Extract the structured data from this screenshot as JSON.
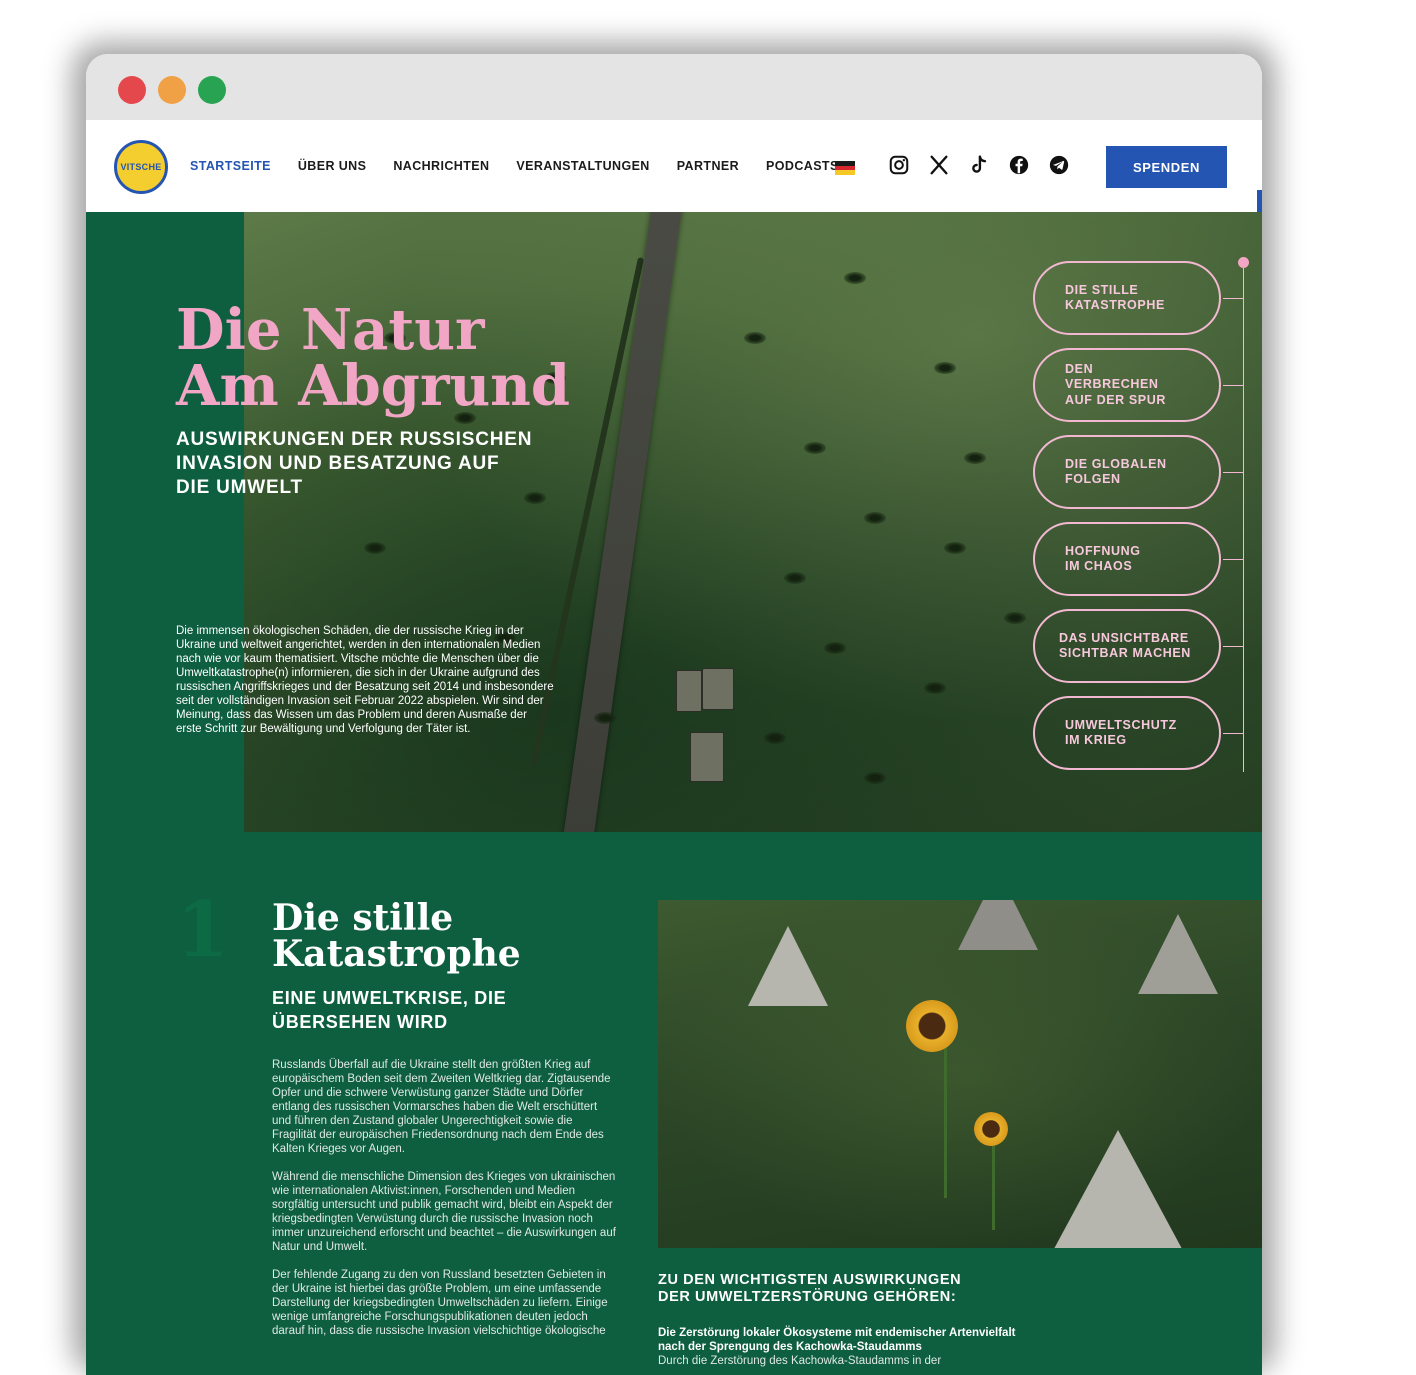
{
  "brand": {
    "logo_text": "VITSCHE"
  },
  "nav": {
    "items": [
      {
        "label": "STARTSEITE",
        "active": true
      },
      {
        "label": "ÜBER UNS",
        "active": false
      },
      {
        "label": "NACHRICHTEN",
        "active": false
      },
      {
        "label": "VERANSTALTUNGEN",
        "active": false
      },
      {
        "label": "PARTNER",
        "active": false
      },
      {
        "label": "PODCASTS",
        "active": false
      }
    ],
    "language_flag": "german-flag-icon",
    "social_icons": [
      "instagram-icon",
      "x-icon",
      "tiktok-icon",
      "facebook-icon",
      "telegram-icon"
    ],
    "donate_label": "SPENDEN"
  },
  "hero": {
    "title_line1": "Die Natur",
    "title_line2": "Am Abgrund",
    "subtitle": "AUSWIRKUNGEN DER RUSSISCHEN INVASION UND BESATZUNG AUF DIE UMWELT",
    "body": "Die immensen ökologischen Schäden, die der russische Krieg in der Ukraine und weltweit angerichtet, werden in den internationalen Medien nach wie vor kaum thematisiert. Vitsche möchte die Menschen über die Umweltkatastrophe(n) informieren, die sich in der Ukraine aufgrund des russischen Angriffskrieges und der Besatzung seit 2014 und insbesondere seit der vollständigen Invasion seit Februar 2022 abspielen. Wir sind der Meinung, dass das Wissen um das Problem und deren Ausmaße der erste Schritt zur Bewältigung und Verfolgung der Täter ist."
  },
  "toc": [
    {
      "label": "DIE STILLE\nKATASTROPHE"
    },
    {
      "label": "DEN\nVERBRECHEN\nAUF DER SPUR"
    },
    {
      "label": "DIE GLOBALEN\nFOLGEN"
    },
    {
      "label": "HOFFNUNG\nIM CHAOS"
    },
    {
      "label": "DAS UNSICHTBARE\nSICHTBAR MACHEN"
    },
    {
      "label": "UMWELTSCHUTZ\nIM KRIEG"
    }
  ],
  "section1": {
    "number": "1",
    "title_line1": "Die stille",
    "title_line2": "Katastrophe",
    "subtitle": "EINE UMWELTKRISE, DIE ÜBERSEHEN WIRD",
    "paragraphs": [
      "Russlands Überfall auf die Ukraine stellt den größten Krieg auf europäischem Boden seit dem Zweiten Weltkrieg dar. Zigtausende Opfer und die schwere Verwüstung ganzer Städte und Dörfer entlang des russischen Vormarsches haben die Welt erschüttert und führen den Zustand globaler Ungerechtigkeit sowie die Fragilität der europäischen Friedensordnung nach dem Ende des Kalten Krieges vor Augen.",
      "Während die menschliche Dimension des Krieges von ukrainischen wie internationalen Aktivist:innen, Forschenden und Medien sorgfältig untersucht und publik gemacht wird, bleibt ein Aspekt der kriegsbedingten Verwüstung durch die russische Invasion noch immer unzureichend erforscht und beachtet – die Auswirkungen auf Natur und Umwelt.",
      "Der fehlende Zugang zu den von Russland besetzten Gebieten in der Ukraine ist hierbei das größte Problem, um eine umfassende Darstellung der kriegsbedingten Umweltschäden zu liefern. Einige wenige umfangreiche Forschungspublikationen deuten jedoch darauf hin, dass die russische Invasion vielschichtige ökologische"
    ],
    "right_heading": "ZU DEN WICHTIGSTEN AUSWIRKUNGEN DER UMWELTZERSTÖRUNG GEHÖREN:",
    "right_bold": "Die Zerstörung lokaler Ökosysteme mit endemischer Artenvielfalt nach der Sprengung des Kachowka-Staudamms",
    "right_text": "Durch die Zerstörung des Kachowka-Staudamms in der"
  }
}
